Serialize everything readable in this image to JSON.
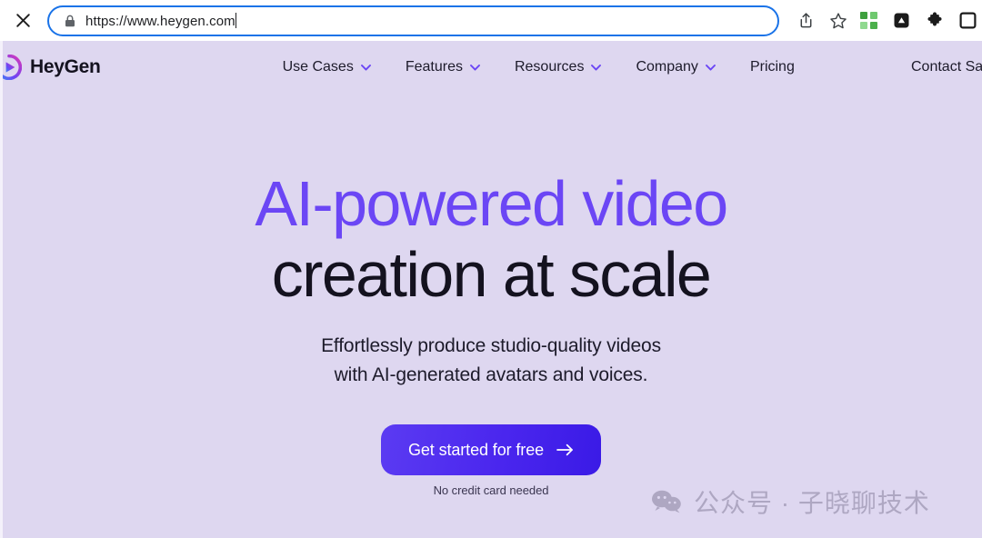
{
  "browser": {
    "close_label": "close-tab",
    "url": "https://www.heygen.com",
    "lock_icon": "lock-icon",
    "share_icon": "share-icon",
    "bookmark_icon": "star-bookmark-icon",
    "extensions": [
      {
        "name": "qr-grid-icon",
        "color": "#4cb04c"
      },
      {
        "name": "dark-triangle-app-icon",
        "color": "#1f1f1f"
      },
      {
        "name": "puzzle-extensions-icon",
        "color": "#1f1f1f"
      },
      {
        "name": "square-outline-icon",
        "color": "#1f1f1f"
      }
    ],
    "focus_ring_color": "#1a73e8"
  },
  "site": {
    "brand": {
      "name": "HeyGen",
      "logo_icon": "heygen-play-logo-icon"
    },
    "nav": [
      {
        "label": "Use Cases",
        "has_dropdown": true
      },
      {
        "label": "Features",
        "has_dropdown": true
      },
      {
        "label": "Resources",
        "has_dropdown": true
      },
      {
        "label": "Company",
        "has_dropdown": true
      },
      {
        "label": "Pricing",
        "has_dropdown": false
      }
    ],
    "nav_right": {
      "label": "Contact Sa"
    },
    "hero": {
      "headline_line1": "AI-powered video",
      "headline_line2": "creation at scale",
      "subhead_line1": "Effortlessly produce studio-quality videos",
      "subhead_line2": "with AI-generated avatars and voices.",
      "cta_label": "Get started for free",
      "cta_arrow_icon": "arrow-right-icon",
      "cta_note": "No credit card needed"
    },
    "colors": {
      "page_bg": "#ded7f0",
      "accent_purple": "#6b46f5",
      "headline_dark": "#14121f",
      "cta_gradient_from": "#5b3bf2",
      "cta_gradient_to": "#3a1ae6"
    }
  },
  "watermark": {
    "icon": "wechat-icon",
    "text": "公众号 · 子晓聊技术"
  }
}
